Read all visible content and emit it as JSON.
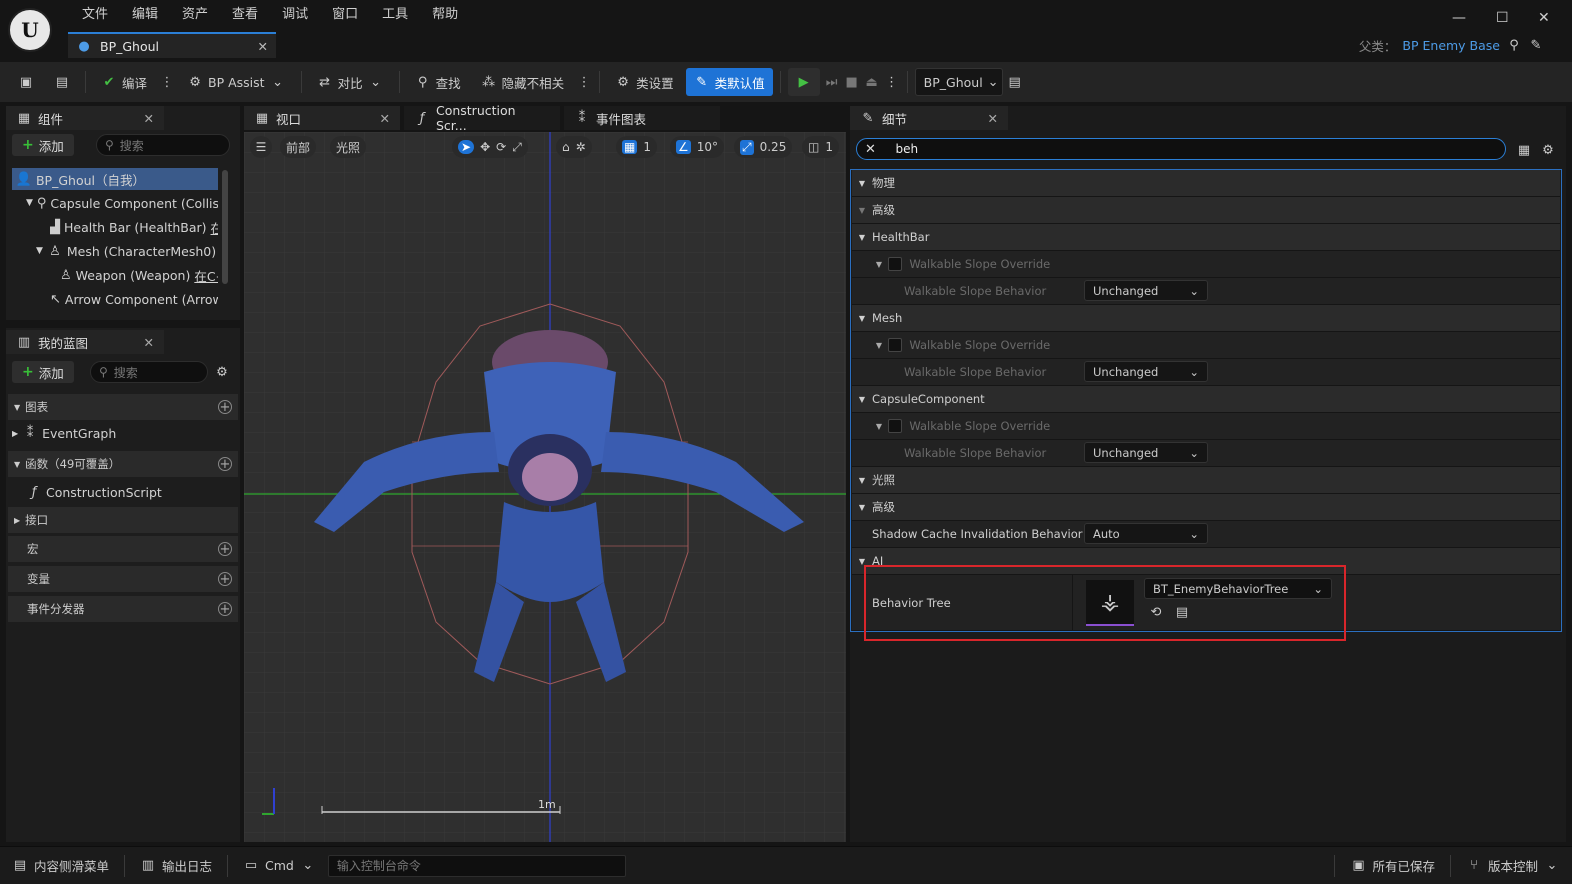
{
  "menu": [
    "文件",
    "编辑",
    "资产",
    "查看",
    "调试",
    "窗口",
    "工具",
    "帮助"
  ],
  "doc_tab": {
    "title": "BP_Ghoul"
  },
  "parent": {
    "label": "父类：",
    "value": "BP Enemy Base"
  },
  "toolbar": {
    "compile": "编译",
    "bp_assist": "BP Assist",
    "diff": "对比",
    "find": "查找",
    "hide": "隐藏不相关",
    "class_settings": "类设置",
    "class_defaults": "类默认值",
    "debug_object": "BP_Ghoul"
  },
  "components": {
    "tab": "组件",
    "add": "添加",
    "search_ph": "搜索",
    "items": [
      {
        "label": "BP_Ghoul（自我）"
      },
      {
        "label": "Capsule Component (Collisi"
      },
      {
        "label": "Health Bar (HealthBar)",
        "tag": "在"
      },
      {
        "label": "Mesh (CharacterMesh0)"
      },
      {
        "label": "Weapon (Weapon)",
        "tag": "在C+"
      },
      {
        "label": "Arrow Component (Arrow"
      }
    ]
  },
  "myblueprint": {
    "tab": "我的蓝图",
    "add": "添加",
    "search_ph": "搜索",
    "graphs": "图表",
    "event_graph": "EventGraph",
    "functions": "函数（49可覆盖）",
    "construction": "ConstructionScript",
    "interfaces": "接口",
    "macros": "宏",
    "variables": "变量",
    "dispatchers": "事件分发器"
  },
  "viewport": {
    "tab": "视口",
    "tab2": "Construction Scr...",
    "tab3": "事件图表",
    "front": "前部",
    "lit": "光照",
    "grid": "1",
    "angle": "10°",
    "scale": "0.25",
    "cam": "1",
    "scale_bar": "1m"
  },
  "details": {
    "tab": "细节",
    "search_value": "beh",
    "rows": {
      "physics": "物理",
      "advanced1": "高级",
      "healthbar": "HealthBar",
      "wso": "Walkable Slope Override",
      "wsb": "Walkable Slope Behavior",
      "unchanged": "Unchanged",
      "mesh": "Mesh",
      "capsule": "CapsuleComponent",
      "lighting": "光照",
      "advanced2": "高级",
      "shadow": "Shadow Cache Invalidation Behavior",
      "auto": "Auto",
      "ai": "AI",
      "behavior_tree": "Behavior Tree",
      "bt_value": "BT_EnemyBehaviorTree"
    }
  },
  "status": {
    "drawer": "内容侧滑菜单",
    "log": "输出日志",
    "cmd": "Cmd",
    "console_ph": "输入控制台命令",
    "saved": "所有已保存",
    "vc": "版本控制"
  },
  "colors": {
    "accent": "#1e73d6",
    "highlight_box": "#d9262b",
    "play": "#44c044"
  }
}
